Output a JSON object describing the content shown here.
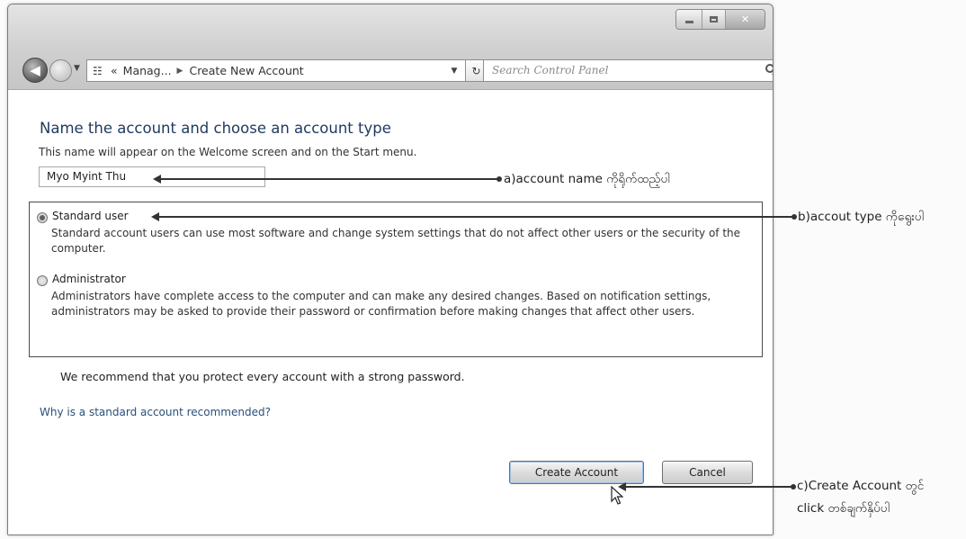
{
  "window": {
    "breadcrumb": [
      "Manag...",
      "Create New Account"
    ],
    "breadcrumb_prefix": "«",
    "search_placeholder": "Search Control Panel"
  },
  "page": {
    "heading": "Name the account and choose an account type",
    "subtext": "This name will appear on the Welcome screen and on the Start menu.",
    "account_name_value": "Myo Myint Thu",
    "options": [
      {
        "label": "Standard user",
        "selected": true,
        "description": "Standard account users can use most software and change system settings that do not affect other users or the security of the computer."
      },
      {
        "label": "Administrator",
        "selected": false,
        "description": "Administrators have complete access to the computer and can make any desired changes. Based on notification settings, administrators may be asked to provide their password or confirmation before making changes that affect other users."
      }
    ],
    "recommendation": "We recommend that you protect every account with a strong password.",
    "why_link": "Why is a standard account recommended?",
    "buttons": {
      "create": "Create Account",
      "cancel": "Cancel"
    }
  },
  "annotations": {
    "a": "a)account name ကိုရိုက်ထည့်ပါ",
    "b": "b)accout type ကိုရွေးပါ",
    "c_line1": "c)Create Account တွင်",
    "c_line2": "click တစ်ချက်နှိပ်ပါ"
  }
}
